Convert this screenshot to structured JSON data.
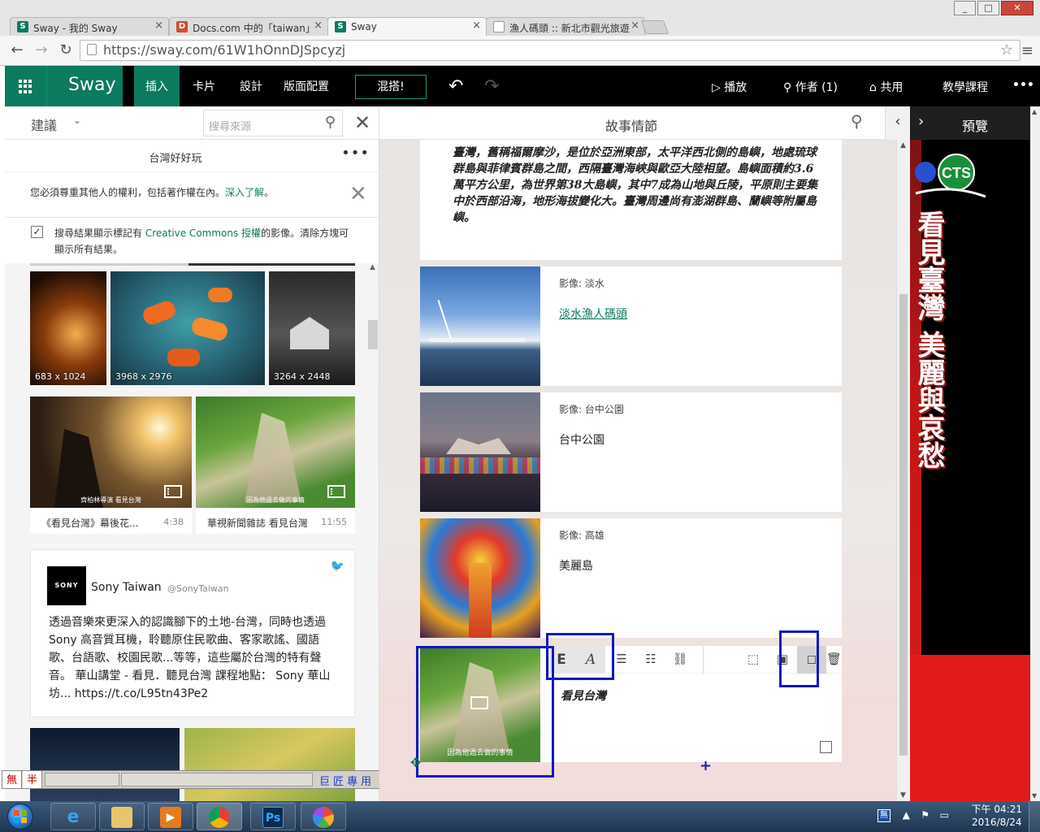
{
  "browser": {
    "tabs": [
      {
        "title": "Sway - 我的 Sway",
        "icon": "sway-icon"
      },
      {
        "title": "Docs.com 中的「taiwan」",
        "icon": "docs-icon"
      },
      {
        "title": "Sway",
        "icon": "sway-icon"
      },
      {
        "title": "漁人碼頭 :: 新北市觀光旅遊",
        "icon": "page-icon"
      }
    ],
    "url": "https://sway.com/61W1hOnnDJSpcyzj",
    "window_buttons": [
      "_",
      "□",
      "✕"
    ]
  },
  "sway_bar": {
    "app_name": "Sway",
    "menu": [
      "插入",
      "卡片",
      "設計",
      "版面配置"
    ],
    "remix": "混搭!",
    "play": "播放",
    "authors": "作者 (1)",
    "share": "共用",
    "tutorial": "教學課程",
    "more": "•••"
  },
  "left_panel": {
    "tab_label": "建議",
    "search_placeholder": "搜尋來源",
    "query": "台灣好好玩",
    "notice_text": "您必須尊重其他人的權利，包括著作權在內。",
    "notice_link": "深入了解",
    "notice_end": "。",
    "cc_text_1": "搜尋結果顯示標記有 ",
    "cc_link": "Creative Commons 授權",
    "cc_text_2": "的影像。清除方塊可顯示所有結果。",
    "images": [
      {
        "dim": "683 x 1024"
      },
      {
        "dim": "3968 x 2976"
      },
      {
        "dim": "3264 x 2448"
      }
    ],
    "videos": [
      {
        "caption": "《看見台灣》幕後花...",
        "duration": "4:38",
        "overlay": "齊柏林導演 看見台灣"
      },
      {
        "caption": "華視新聞雜誌 看見台灣",
        "duration": "11:55",
        "overlay": "因為他過去做的事情"
      }
    ],
    "tweet": {
      "logo": "SONY",
      "name": "Sony Taiwan",
      "handle": "@SonyTaiwan",
      "text": "透過音樂來更深入的認識腳下的土地-台灣，同時也透過 Sony 高音質耳機，聆聽原住民歌曲、客家歌謠、國語歌、台語歌、校園民歌...等等，這些屬於台灣的特有聲音。 華山講堂 - 看見．聽見台灣 課程地點： Sony 華山坊... https://t.co/L95tn43Pe2"
    }
  },
  "ime": {
    "mode1": "無",
    "mode2": "半",
    "label": "巨匠專用"
  },
  "storyline": {
    "title": "故事情節",
    "intro_text": "臺灣，舊稱福爾摩沙，是位於亞洲東部，太平洋西北側的島嶼，地處琉球群島與菲律賓群島之間，西隔臺灣海峽與歐亞大陸相望。島嶼面積約3.6萬平方公里，為世界第38大島嶼，其中7成為山地與丘陵，平原則主要集中於西部沿海，地形海拔變化大。臺灣周邊尚有澎湖群島、蘭嶼等附屬島嶼。",
    "cards": [
      {
        "label": "影像: 淡水",
        "caption": "淡水漁人碼頭"
      },
      {
        "label": "影像: 台中公園",
        "caption": "台中公園"
      },
      {
        "label": "影像: 高雄",
        "caption": "美麗島"
      }
    ],
    "active_card": {
      "caption": "看見台灣",
      "overlay": "因為他過去做的事情",
      "toolbar": [
        "E",
        "A"
      ]
    }
  },
  "preview": {
    "label": "預覽",
    "channel": "CTS",
    "vertical_text": "看見臺灣 美麗與哀愁"
  },
  "taskbar": {
    "time": "下午 04:21",
    "date": "2016/8/24",
    "ime_icon": "無"
  },
  "colors": {
    "sway_green": "#0b7a5f",
    "highlight_blue": "#1018c0",
    "tray_blue": "#1e3550"
  }
}
